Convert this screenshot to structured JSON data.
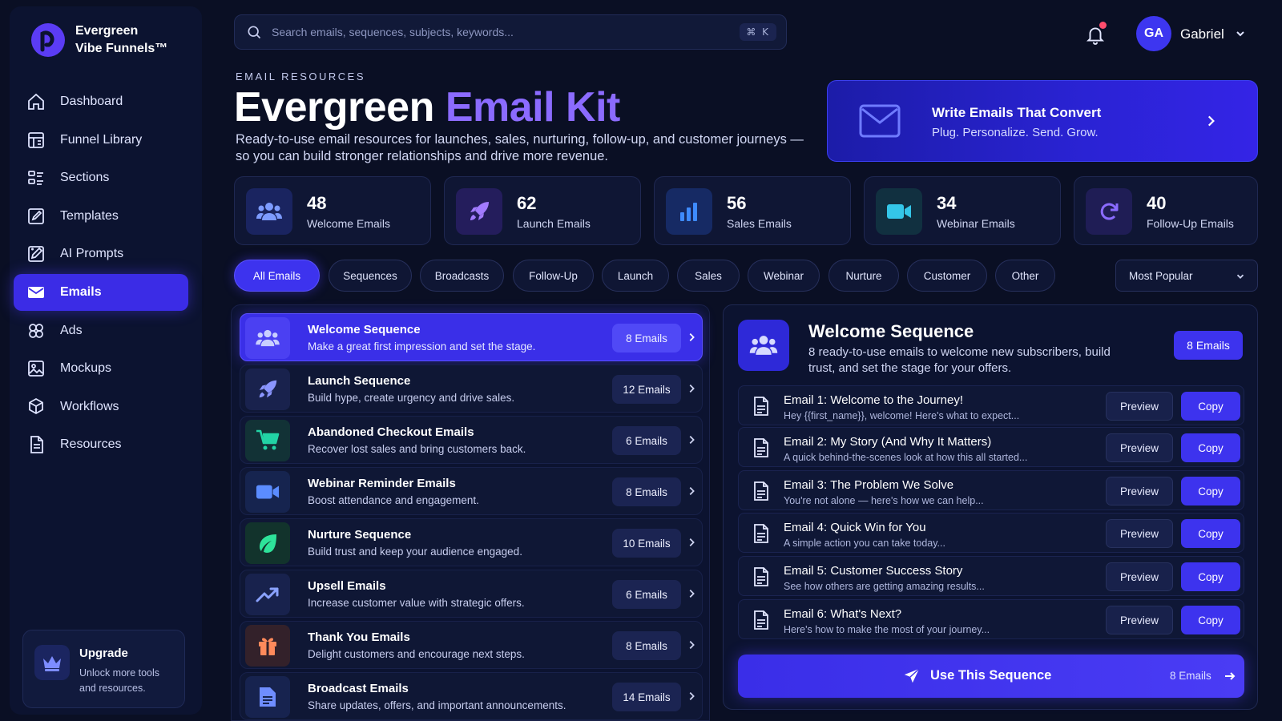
{
  "brand": {
    "line1": "Evergreen",
    "line2": "Vibe Funnels™",
    "accent": "#5b3cf5"
  },
  "nav": [
    {
      "label": "Dashboard",
      "icon": "home-icon"
    },
    {
      "label": "Funnel Library",
      "icon": "library-icon"
    },
    {
      "label": "Sections",
      "icon": "sections-icon"
    },
    {
      "label": "Templates",
      "icon": "templates-icon"
    },
    {
      "label": "AI Prompts",
      "icon": "ai-prompts-icon"
    },
    {
      "label": "Emails",
      "icon": "mail-icon",
      "active": true
    },
    {
      "label": "Ads",
      "icon": "ads-icon"
    },
    {
      "label": "Mockups",
      "icon": "image-icon"
    },
    {
      "label": "Workflows",
      "icon": "workflow-icon"
    },
    {
      "label": "Resources",
      "icon": "document-icon"
    }
  ],
  "upgrade": {
    "title": "Upgrade",
    "text": "Unlock more tools and resources."
  },
  "search": {
    "placeholder": "Search emails, sequences, subjects, keywords...",
    "shortcut": "⌘ K"
  },
  "user": {
    "initials": "GA",
    "name": "Gabriel"
  },
  "header": {
    "eyebrow": "EMAIL RESOURCES",
    "title_part1": "Evergreen",
    "title_part2": "Email Kit",
    "description": "Ready-to-use email resources for launches, sales, nurturing, follow-up, and customer journeys — so you can build stronger relationships and drive more revenue."
  },
  "promo": {
    "title": "Write Emails That Convert",
    "subtitle": "Plug. Personalize. Send. Grow."
  },
  "stats": [
    {
      "value": "48",
      "label": "Welcome Emails",
      "icon": "users-icon",
      "color": "#5b7bff"
    },
    {
      "value": "62",
      "label": "Launch Emails",
      "icon": "rocket-icon",
      "color": "#a27bff"
    },
    {
      "value": "56",
      "label": "Sales Emails",
      "icon": "bar-chart-icon",
      "color": "#3e8bff"
    },
    {
      "value": "34",
      "label": "Webinar Emails",
      "icon": "video-icon",
      "color": "#34c6e8"
    },
    {
      "value": "40",
      "label": "Follow-Up Emails",
      "icon": "refresh-icon",
      "color": "#8a6bff"
    }
  ],
  "filters": [
    "All Emails",
    "Sequences",
    "Broadcasts",
    "Follow-Up",
    "Launch",
    "Sales",
    "Webinar",
    "Nurture",
    "Customer",
    "Other"
  ],
  "sort": {
    "selected": "Most Popular"
  },
  "sequences": [
    {
      "title": "Welcome Sequence",
      "desc": "Make a great first impression and set the stage.",
      "count": "8 Emails",
      "icon": "users-icon",
      "color": "#6f7bff",
      "active": true
    },
    {
      "title": "Launch Sequence",
      "desc": "Build hype, create urgency and drive sales.",
      "count": "12 Emails",
      "icon": "rocket-icon",
      "color": "#8a95ff"
    },
    {
      "title": "Abandoned Checkout Emails",
      "desc": "Recover lost sales and bring customers back.",
      "count": "6 Emails",
      "icon": "cart-icon",
      "color": "#22d3a5"
    },
    {
      "title": "Webinar Reminder Emails",
      "desc": "Boost attendance and engagement.",
      "count": "8 Emails",
      "icon": "video-icon",
      "color": "#5b8cff"
    },
    {
      "title": "Nurture Sequence",
      "desc": "Build trust and keep your audience engaged.",
      "count": "10 Emails",
      "icon": "leaf-icon",
      "color": "#2ee39a"
    },
    {
      "title": "Upsell Emails",
      "desc": "Increase customer value with strategic offers.",
      "count": "6 Emails",
      "icon": "trending-up-icon",
      "color": "#8aa2ff"
    },
    {
      "title": "Thank You Emails",
      "desc": "Delight customers and encourage next steps.",
      "count": "8 Emails",
      "icon": "gift-icon",
      "color": "#ff8a5b"
    },
    {
      "title": "Broadcast Emails",
      "desc": "Share updates, offers, and important announcements.",
      "count": "14 Emails",
      "icon": "document-icon",
      "color": "#6f8dff"
    }
  ],
  "detail": {
    "title": "Welcome Sequence",
    "desc": "8 ready-to-use emails to welcome new subscribers, build trust, and set the stage for your offers.",
    "count": "8 Emails",
    "preview_label": "Preview",
    "copy_label": "Copy",
    "emails": [
      {
        "title": "Email 1: Welcome to the Journey!",
        "preview": "Hey {{first_name}}, welcome! Here's what to expect..."
      },
      {
        "title": "Email 2: My Story (And Why It Matters)",
        "preview": "A quick behind-the-scenes look at how this all started..."
      },
      {
        "title": "Email 3: The Problem We Solve",
        "preview": "You're not alone — here's how we can help..."
      },
      {
        "title": "Email 4: Quick Win for You",
        "preview": "A simple action you can take today..."
      },
      {
        "title": "Email 5: Customer Success Story",
        "preview": "See how others are getting amazing results..."
      },
      {
        "title": "Email 6: What's Next?",
        "preview": "Here's how to make the most of your journey..."
      }
    ],
    "use_label": "Use This Sequence",
    "use_count": "8 Emails"
  }
}
